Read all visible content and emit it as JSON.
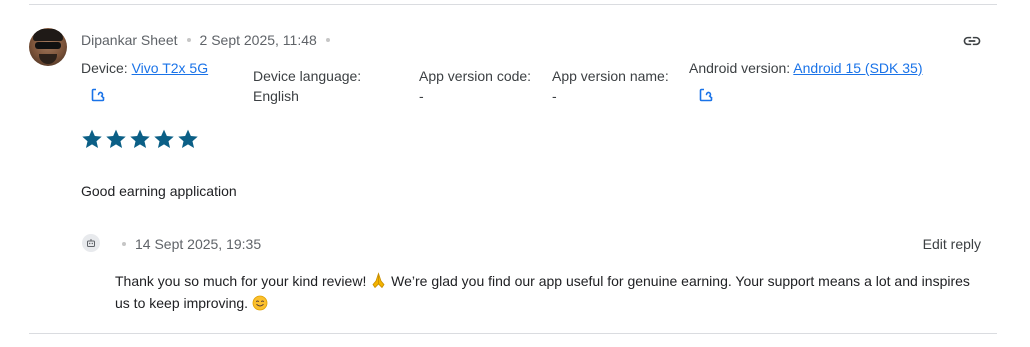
{
  "review": {
    "author": "Dipankar Sheet",
    "timestamp": "2 Sept 2025, 11:48",
    "device_label": "Device:",
    "device_value": "Vivo T2x 5G",
    "language_label": "Device language:",
    "language_value": "English",
    "app_version_code_label": "App version code:",
    "app_version_code_value": "-",
    "app_version_name_label": "App version name:",
    "app_version_name_value": "-",
    "android_version_label": "Android version:",
    "android_version_value": "Android 15 (SDK 35)",
    "rating": 5,
    "rating_max": 5,
    "text": "Good earning application"
  },
  "reply": {
    "timestamp": "14 Sept 2025, 19:35",
    "edit_label": "Edit reply",
    "text_part1": "Thank you so much for your kind review! ",
    "text_part2": " We’re glad you find our app useful for genuine earning. Your support means a lot and inspires us to keep improving. "
  },
  "colors": {
    "star": "#0b5f86",
    "link": "#1a73e8",
    "divider": "#dadce0"
  },
  "icons": {
    "link": "link-icon",
    "open_external": "open-in-new-icon",
    "reply": "reply-bot-icon"
  }
}
